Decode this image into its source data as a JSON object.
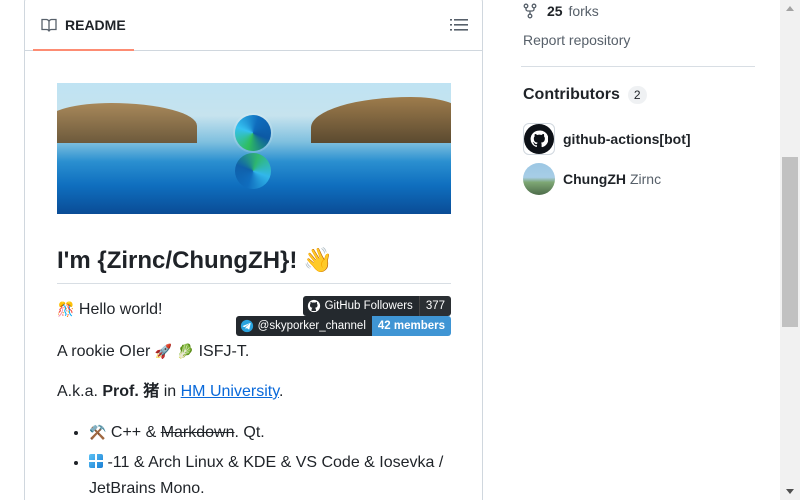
{
  "readme": {
    "tab_label": "README",
    "heading": "I'm {Zirnc/ChungZH}!",
    "heading_emoji": "👋",
    "hello_emoji": "🎊",
    "hello_text": "Hello world!",
    "badges": {
      "followers_label": "GitHub Followers",
      "followers_count": "377",
      "telegram_label": "@skyporker_channel",
      "telegram_members": "42 members"
    },
    "rookie_text_1": "A rookie OIer",
    "rookie_emoji_1": "🚀",
    "rookie_emoji_2": "🥬",
    "rookie_text_2": "ISFJ-T.",
    "aka_prefix": "A.k.a.",
    "aka_bold": "Prof. 猪",
    "aka_in": "in",
    "aka_link": "HM University",
    "aka_suffix": ".",
    "bullets": [
      {
        "emoji": "⚒️",
        "text_1": "C++ &",
        "strike": "Markdown",
        "text_2": ". Qt."
      },
      {
        "text": "-11 & Arch Linux & KDE & VS Code & Iosevka / JetBrains Mono."
      }
    ]
  },
  "sidebar": {
    "forks_count": "25",
    "forks_label": "forks",
    "report_label": "Report repository",
    "contributors_title": "Contributors",
    "contributors_count": "2",
    "contributors": [
      {
        "name": "github-actions[bot]",
        "login": ""
      },
      {
        "name": "ChungZH",
        "login": "Zirnc"
      }
    ]
  },
  "colors": {
    "tab_underline": "#fd8c73",
    "link": "#0969da",
    "telegram_badge": "#3f95d4"
  }
}
